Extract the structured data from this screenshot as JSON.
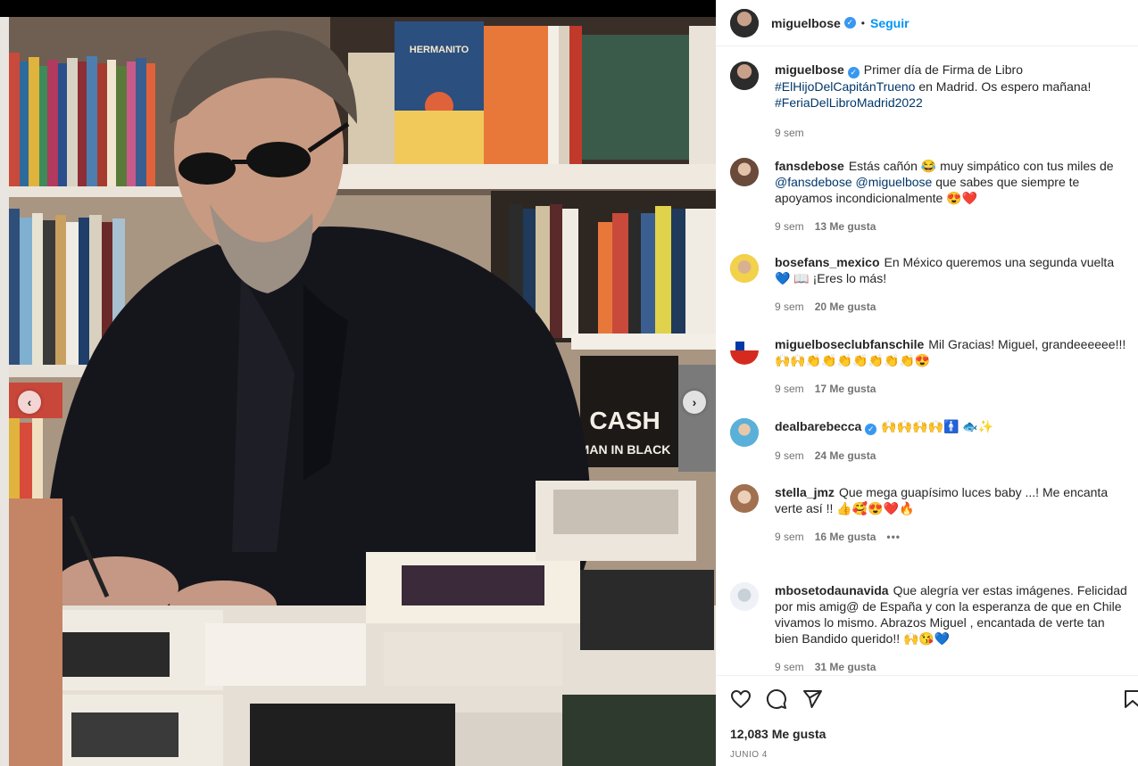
{
  "post": {
    "username": "miguelbose",
    "follow_label": "Seguir",
    "separator": "•",
    "caption_text": "Primer día de Firma de Libro",
    "caption_tag1": "#ElHijoDelCapitánTrueno",
    "caption_mid": " en Madrid. Os espero mañana!",
    "caption_tag2": "#FeriaDelLibroMadrid2022",
    "caption_time": "9 sem",
    "likes_total": "12,083 Me gusta",
    "date": "JUNIO 4"
  },
  "comments": [
    {
      "user": "fansdebose",
      "text_a": "Estás cañón 😂 muy simpático con tus miles de ",
      "tag1": "@fansdebose",
      "tag2": "@miguelbose",
      "text_b": " que sabes que siempre te apoyamos incondicionalmente 😍❤️",
      "time": "9 sem",
      "likes": "13 Me gusta"
    },
    {
      "user": "bosefans_mexico",
      "text": "En México queremos una segunda vuelta 💙 📖 ¡Eres lo más!",
      "time": "9 sem",
      "likes": "20 Me gusta"
    },
    {
      "user": "miguelboseclubfanschile",
      "text": "Mil Gracias! Miguel, grandeeeeee!!! 🙌🙌👏👏👏👏👏👏👏😍",
      "time": "9 sem",
      "likes": "17 Me gusta"
    },
    {
      "user": "dealbarebecca",
      "text": "🙌🙌🙌🙌🚹 🐟✨",
      "time": "9 sem",
      "likes": "24 Me gusta"
    },
    {
      "user": "stella_jmz",
      "text": "Que mega guapísimo luces baby ...! Me encanta verte así !! 👍🥰😍❤️🔥",
      "time": "9 sem",
      "likes": "16 Me gusta",
      "more": "•••"
    },
    {
      "user": "mbosetodaunavida",
      "text": "Que alegría ver estas imágenes. Felicidad por mis amig@ de España y con la esperanza de que en Chile vivamos lo mismo. Abrazos Miguel , encantada de verte tan bien Bandido querido!! 🙌😘💙",
      "time": "9 sem",
      "likes": "31 Me gusta"
    }
  ],
  "colors": {
    "accent": "#0095f6",
    "verified": "#3897f0",
    "link": "#00376b",
    "muted": "#737373"
  },
  "icons": [
    "chevron-left-icon",
    "chevron-right-icon",
    "heart-icon",
    "comment-icon",
    "share-icon",
    "bookmark-icon",
    "verified-icon"
  ],
  "media": {
    "book_titles": [
      "HERMANITO",
      "CASH",
      "MAN IN BLACK"
    ],
    "prev_glyph": "‹",
    "next_glyph": "›"
  }
}
